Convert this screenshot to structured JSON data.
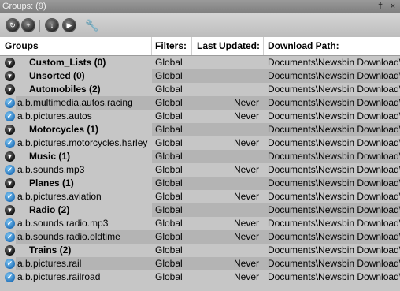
{
  "title": "Groups: (9)",
  "title_buttons": {
    "pin": "†",
    "close": "×"
  },
  "toolbar": {
    "buttons": [
      {
        "icon": "refresh-icon",
        "glyph": "↻"
      },
      {
        "icon": "add-icon",
        "glyph": "+"
      },
      {
        "icon": "download-icon",
        "glyph": "↓"
      },
      {
        "icon": "play-icon",
        "glyph": "▶"
      },
      {
        "icon": "wrench-icon",
        "glyph": "🔧"
      }
    ]
  },
  "columns": {
    "groups": "Groups",
    "filters": "Filters:",
    "last_updated": "Last Updated:",
    "download_path": "Download Path:"
  },
  "rows": [
    {
      "type": "group",
      "name": "Custom_Lists (0)",
      "filter": "Global",
      "updated": "",
      "path": "Documents\\Newsbin Download\\",
      "alt": false
    },
    {
      "type": "group",
      "name": "Unsorted (0)",
      "filter": "Global",
      "updated": "",
      "path": "Documents\\Newsbin Download\\",
      "alt": true
    },
    {
      "type": "group",
      "name": "Automobiles (2)",
      "filter": "Global",
      "updated": "",
      "path": "Documents\\Newsbin Download\\",
      "alt": false
    },
    {
      "type": "child",
      "name": "a.b.multimedia.autos.racing",
      "filter": "Global",
      "updated": "Never",
      "path": "Documents\\Newsbin Download\\",
      "alt": true
    },
    {
      "type": "child",
      "name": "a.b.pictures.autos",
      "filter": "Global",
      "updated": "Never",
      "path": "Documents\\Newsbin Download\\",
      "alt": false
    },
    {
      "type": "group",
      "name": "Motorcycles (1)",
      "filter": "Global",
      "updated": "",
      "path": "Documents\\Newsbin Download\\",
      "alt": true
    },
    {
      "type": "child",
      "name": "a.b.pictures.motorcycles.harley",
      "filter": "Global",
      "updated": "Never",
      "path": "Documents\\Newsbin Download\\",
      "alt": false
    },
    {
      "type": "group",
      "name": "Music (1)",
      "filter": "Global",
      "updated": "",
      "path": "Documents\\Newsbin Download\\",
      "alt": true
    },
    {
      "type": "child",
      "name": "a.b.sounds.mp3",
      "filter": "Global",
      "updated": "Never",
      "path": "Documents\\Newsbin Download\\",
      "alt": false
    },
    {
      "type": "group",
      "name": "Planes (1)",
      "filter": "Global",
      "updated": "",
      "path": "Documents\\Newsbin Download\\",
      "alt": true
    },
    {
      "type": "child",
      "name": "a.b.pictures.aviation",
      "filter": "Global",
      "updated": "Never",
      "path": "Documents\\Newsbin Download\\",
      "alt": false
    },
    {
      "type": "group",
      "name": "Radio (2)",
      "filter": "Global",
      "updated": "",
      "path": "Documents\\Newsbin Download\\",
      "alt": true
    },
    {
      "type": "child",
      "name": "a.b.sounds.radio.mp3",
      "filter": "Global",
      "updated": "Never",
      "path": "Documents\\Newsbin Download\\",
      "alt": false
    },
    {
      "type": "child",
      "name": "a.b.sounds.radio.oldtime",
      "filter": "Global",
      "updated": "Never",
      "path": "Documents\\Newsbin Download\\",
      "alt": true
    },
    {
      "type": "group",
      "name": "Trains (2)",
      "filter": "Global",
      "updated": "",
      "path": "Documents\\Newsbin Download\\",
      "alt": false
    },
    {
      "type": "child",
      "name": "a.b.pictures.rail",
      "filter": "Global",
      "updated": "Never",
      "path": "Documents\\Newsbin Download\\",
      "alt": true
    },
    {
      "type": "child",
      "name": "a.b.pictures.railroad",
      "filter": "Global",
      "updated": "Never",
      "path": "Documents\\Newsbin Download\\",
      "alt": false
    }
  ]
}
